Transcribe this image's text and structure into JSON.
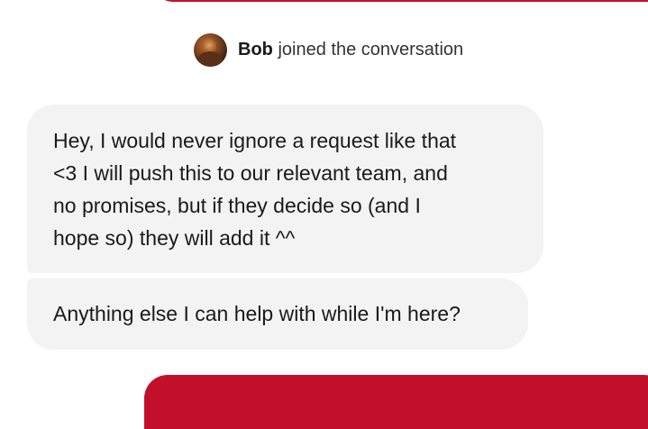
{
  "chat": {
    "join_event": {
      "name": "Bob",
      "text": " joined the conversation"
    },
    "messages": [
      {
        "lines": [
          "Hey, I would never ignore a request like that",
          "<3 I will push this to our relevant team, and",
          "no promises, but if they decide so (and I",
          "hope so) they will add it ^^"
        ]
      },
      {
        "text": "Anything else I can help with while I'm here?"
      }
    ]
  },
  "colors": {
    "user_bubble": "#c2102b",
    "agent_bubble": "#f3f3f3",
    "background": "#ffffff"
  },
  "icons": {
    "avatar": "bob-avatar"
  }
}
